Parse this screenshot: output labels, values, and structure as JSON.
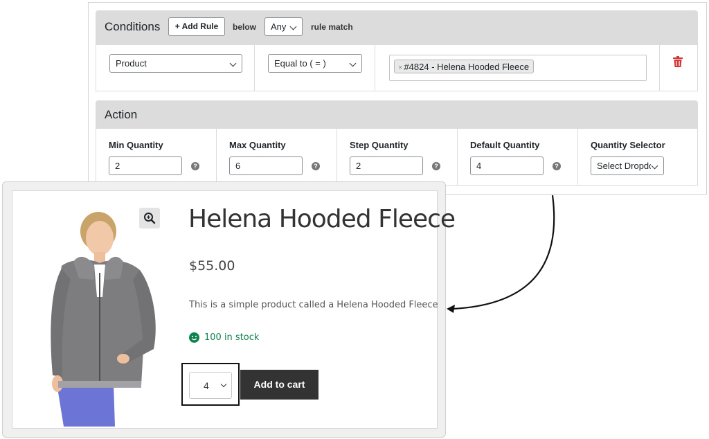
{
  "conditions": {
    "title": "Conditions",
    "add_rule_label": "+ Add Rule",
    "below_label": "below",
    "match_value": "Any",
    "rule_match_label": "rule match",
    "rule": {
      "field": "Product",
      "operator": "Equal to ( = )",
      "tag_remove": "×",
      "tag_label": "#4824 - Helena Hooded Fleece"
    }
  },
  "action": {
    "title": "Action",
    "fields": [
      {
        "label": "Min Quantity",
        "value": "2"
      },
      {
        "label": "Max Quantity",
        "value": "6"
      },
      {
        "label": "Step Quantity",
        "value": "2"
      },
      {
        "label": "Default Quantity",
        "value": "4"
      }
    ],
    "selector_label": "Quantity Selector",
    "selector_value": "Select Dropdown",
    "help_glyph": "?"
  },
  "product": {
    "title": "Helena Hooded Fleece",
    "price": "$55.00",
    "description": "This is a simple product called a Helena Hooded Fleece",
    "stock": "100 in stock",
    "quantity": "4",
    "add_to_cart": "Add to cart"
  },
  "colors": {
    "stock_green": "#0f834d",
    "delete_red": "#d63638",
    "cart_button": "#333333"
  },
  "icons": [
    "plus-icon",
    "chevron-down-icon",
    "trash-icon",
    "help-icon",
    "zoom-icon",
    "smiley-icon",
    "arrow-connector"
  ]
}
